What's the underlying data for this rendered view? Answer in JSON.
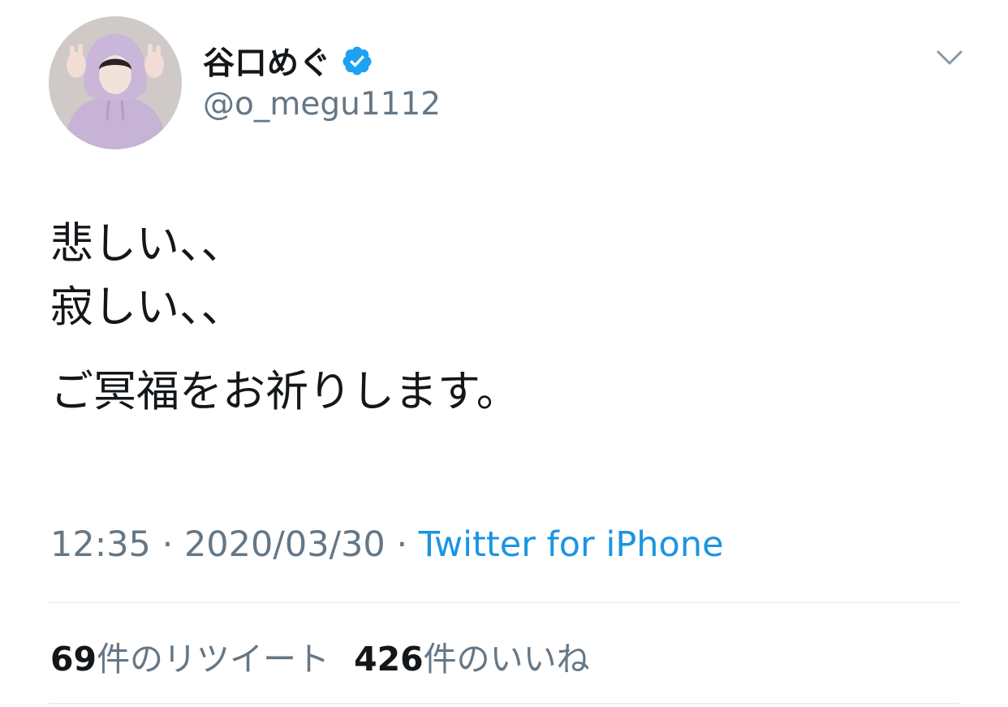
{
  "author": {
    "display_name": "谷口めぐ",
    "handle": "@o_megu1112",
    "verified": true,
    "avatar_icon": "avatar-photo"
  },
  "tweet": {
    "lines": [
      "悲しい、、",
      "寂しい、、",
      "ご冥福をお祈りします。"
    ]
  },
  "meta": {
    "time": "12:35",
    "separator": " · ",
    "date": "2020/03/30",
    "source": "Twitter for iPhone"
  },
  "stats": {
    "retweets_count": "69",
    "retweets_label": "件のリツイート",
    "likes_count": "426",
    "likes_label": "件のいいね"
  },
  "colors": {
    "text": "#14171a",
    "secondary": "#657786",
    "link": "#1b95e0",
    "verified": "#1da1f2",
    "divider": "#e1e8ed"
  },
  "icons": {
    "menu": "chevron-down-icon",
    "verified": "verified-badge-icon"
  }
}
